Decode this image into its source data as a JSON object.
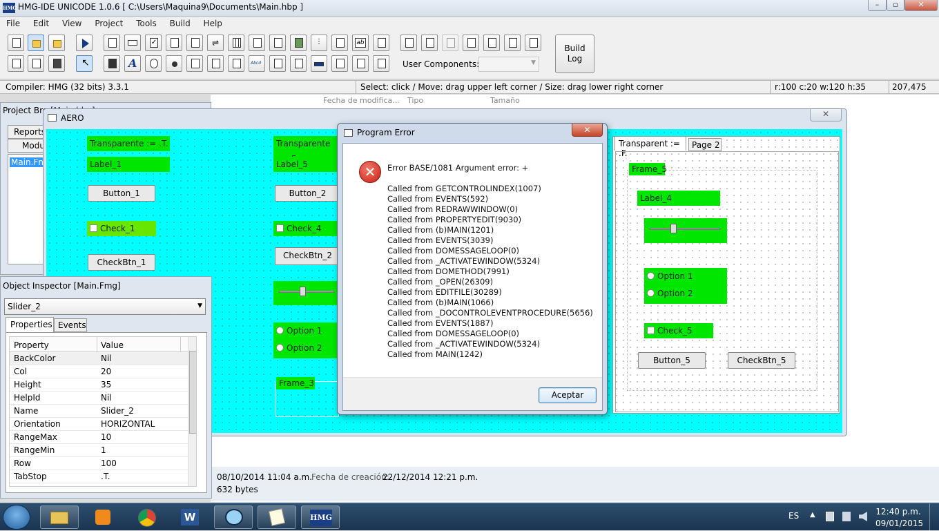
{
  "window": {
    "title": "HMG-IDE  UNICODE  1.0.6  [ C:\\Users\\Maquina9\\Documents\\Main.hbp ]",
    "icon_text": "HMG"
  },
  "menu": [
    "File",
    "Edit",
    "View",
    "Project",
    "Tools",
    "Build",
    "Help"
  ],
  "toolbar": {
    "build_log": "Build\nLog",
    "user_components_label": "User Components:"
  },
  "status": {
    "compiler": "Compiler: HMG (32 bits)  3.3.1",
    "hint": "Select: click / Move: drag upper left corner / Size: drag lower right corner",
    "geometry": "r:100 c:20 w:120 h:35",
    "coords": "207,475"
  },
  "explorer": {
    "columns": [
      "Fecha de modifica...",
      "Tipo",
      "Tamaño"
    ],
    "modified_label": "08/10/2014 11:04 a.m.",
    "created_label": "Fecha de creación:",
    "created_value": "22/12/2014 12:21 p.m.",
    "size": "632 bytes"
  },
  "project_browser": {
    "title": "Project Bro",
    "title_tail": "[Main.hbp]",
    "tabs": [
      "Reports",
      "Modu"
    ],
    "item": "Main.Fn"
  },
  "form": {
    "title": "AERO",
    "col1": {
      "transparent": "Transparente := .T.",
      "label": "Label_1",
      "button": "Button_1",
      "check": "Check_1",
      "checkbtn": "CheckBtn_1"
    },
    "col2": {
      "transparent": "Transparente := .F.",
      "label": "Label_5",
      "button": "Button_2",
      "check": "Check_4",
      "checkbtn": "CheckBtn_2",
      "option1": "Option 1",
      "option2": "Option 2",
      "frame": "Frame_3"
    },
    "tab": {
      "tab1": "Transparent := .F.",
      "tab2": "Page 2",
      "frame": "Frame_5",
      "label": "Label_4",
      "option1": "Option 1",
      "option2": "Option 2",
      "check": "Check_5",
      "button": "Button_5",
      "checkbtn": "CheckBtn_5"
    }
  },
  "inspector": {
    "title": "Object Inspector [Main.Fmg]",
    "selected": "Slider_2",
    "tabs": [
      "Properties",
      "Events"
    ],
    "headers": [
      "Property",
      "Value"
    ],
    "rows": [
      [
        "BackColor",
        "Nil"
      ],
      [
        "Col",
        "20"
      ],
      [
        "Height",
        "35"
      ],
      [
        "HelpId",
        "Nil"
      ],
      [
        "Name",
        "Slider_2"
      ],
      [
        "Orientation",
        "HORIZONTAL"
      ],
      [
        "RangeMax",
        "10"
      ],
      [
        "RangeMin",
        "1"
      ],
      [
        "Row",
        "100"
      ],
      [
        "TabStop",
        ".T."
      ]
    ]
  },
  "dialog": {
    "title": "Program Error",
    "error": "Error BASE/1081  Argument error: +",
    "lines": [
      "Called from GETCONTROLINDEX(1007)",
      "Called from EVENTS(592)",
      "Called from REDRAWWINDOW(0)",
      "Called from PROPERTYEDIT(9030)",
      "Called from (b)MAIN(1201)",
      "Called from EVENTS(3039)",
      "Called from DOMESSAGELOOP(0)",
      "Called from _ACTIVATEWINDOW(5324)",
      "Called from DOMETHOD(7991)",
      "Called from _OPEN(26309)",
      "Called from EDITFILE(30289)",
      "Called from (b)MAIN(1066)",
      "Called from _DOCONTROLEVENTPROCEDURE(5656)",
      "Called from EVENTS(1887)",
      "Called from DOMESSAGELOOP(0)",
      "Called from _ACTIVATEWINDOW(5324)",
      "Called from MAIN(1242)"
    ],
    "ok": "Aceptar"
  },
  "taskbar": {
    "lang": "ES",
    "time": "12:40 p.m.",
    "date": "09/01/2015",
    "hmg": "HMG"
  }
}
